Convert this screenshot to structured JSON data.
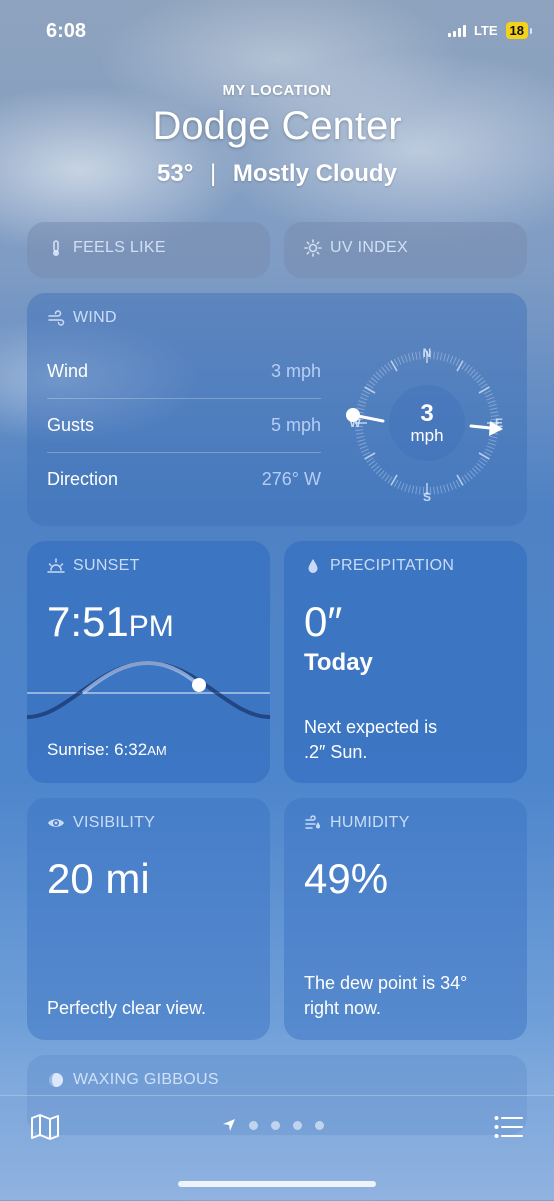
{
  "status": {
    "time": "6:08",
    "network": "LTE",
    "battery": "18"
  },
  "header": {
    "location_label": "MY LOCATION",
    "city": "Dodge Center",
    "temperature": "53°",
    "separator": "|",
    "condition": "Mostly Cloudy"
  },
  "cards": {
    "feels_like": {
      "title": "FEELS LIKE"
    },
    "uv_index": {
      "title": "UV INDEX"
    },
    "wind": {
      "title": "WIND",
      "rows": [
        {
          "label": "Wind",
          "value": "3 mph"
        },
        {
          "label": "Gusts",
          "value": "5 mph"
        },
        {
          "label": "Direction",
          "value": "276° W"
        }
      ],
      "compass": {
        "speed": "3",
        "unit": "mph",
        "n": "N",
        "e": "E",
        "s": "S",
        "w": "W"
      }
    },
    "sunset": {
      "title": "SUNSET",
      "time": "7:51",
      "ampm": "PM",
      "sunrise_prefix": "Sunrise: 6:32",
      "sunrise_ampm": "AM"
    },
    "precipitation": {
      "title": "PRECIPITATION",
      "amount": "0″",
      "period": "Today",
      "note_line1": "Next expected is",
      "note_line2": ".2″ Sun."
    },
    "visibility": {
      "title": "VISIBILITY",
      "value": "20 mi",
      "note": "Perfectly clear view."
    },
    "humidity": {
      "title": "HUMIDITY",
      "value": "49%",
      "note_line1": "The dew point is 34°",
      "note_line2": "right now."
    },
    "moon": {
      "title": "WAXING GIBBOUS"
    }
  },
  "tabbar": {
    "icons": [
      "map-icon",
      "location-arrow-icon",
      "list-icon"
    ],
    "page_dots": 4
  }
}
